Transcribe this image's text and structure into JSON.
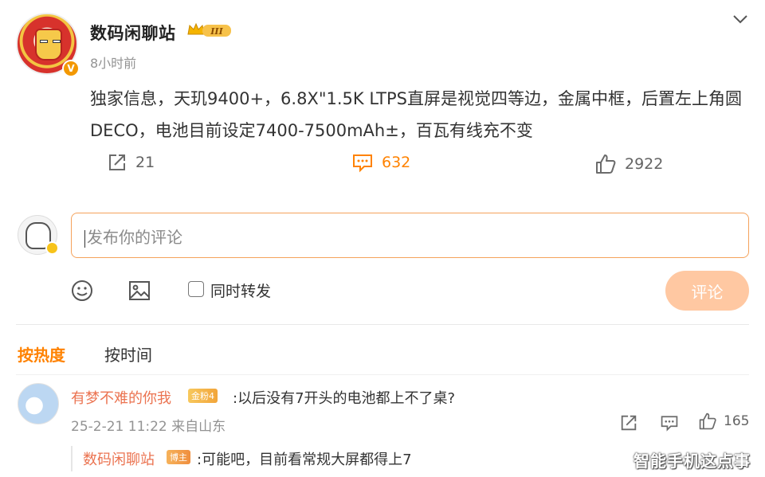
{
  "post": {
    "username": "数码闲聊站",
    "level_badge": "III",
    "time": "8小时前",
    "content": "独家信息，天玑9400+，6.8X\"1.5K LTPS直屏是视觉四等边，金属中框，后置左上角圆DECO，电池目前设定7400-7500mAh±，百瓦有线充不变",
    "verified_mark": "V",
    "repost_count": "21",
    "comment_count": "632",
    "like_count": "2922"
  },
  "composer": {
    "placeholder": "发布你的评论",
    "also_repost_label": "同时转发",
    "submit_label": "评论"
  },
  "sort": {
    "hot_label": "按热度",
    "time_label": "按时间"
  },
  "comment": {
    "username": "有梦不难的你我",
    "fan_badge": "金粉4",
    "text": ":以后没有7开头的电池都上不了桌?",
    "meta": "25-2-21 11:22 来自山东",
    "like_count": "165"
  },
  "reply": {
    "username": "数码闲聊站",
    "badge": "博主",
    "text": ":可能吧，目前看常规大屏都得上7"
  },
  "watermark": "智能手机这点事",
  "colors": {
    "accent": "#ff8200",
    "name_link": "#eb7350",
    "submit_disabled": "#ffc8a2",
    "input_border": "#f5a25b"
  },
  "icons": [
    "chevron-down-icon",
    "repost-icon",
    "comment-icon",
    "like-icon",
    "emoji-icon",
    "image-icon"
  ]
}
